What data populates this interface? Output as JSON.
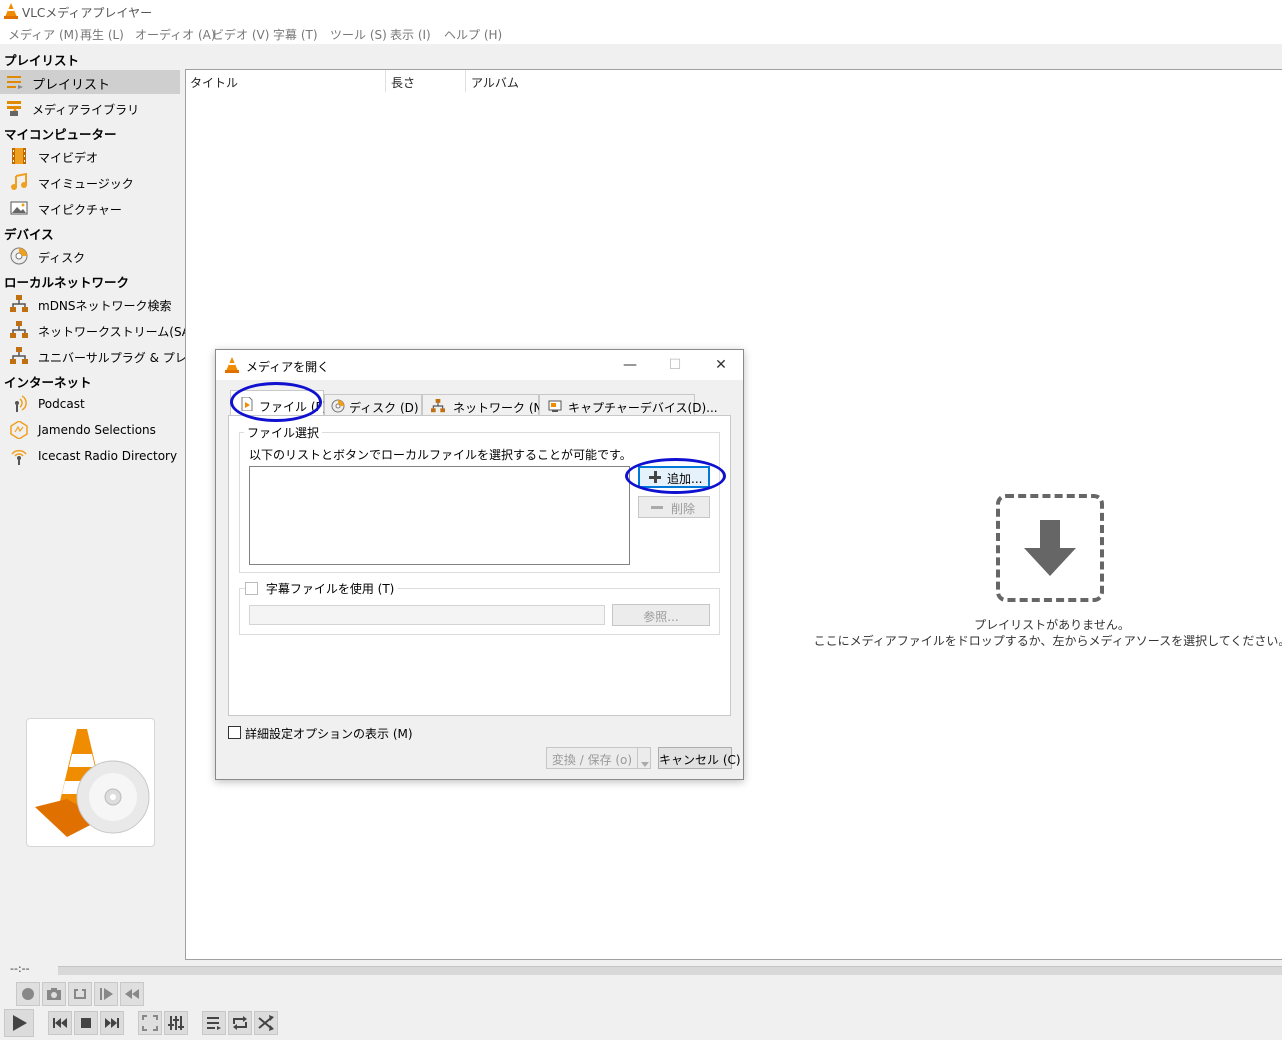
{
  "window": {
    "title": "VLCメディアプレイヤー"
  },
  "menu": [
    "メディア (M)",
    "再生 (L)",
    "オーディオ (A)",
    "ビデオ (V)",
    "字幕 (T)",
    "ツール (S)",
    "表示 (I)",
    "ヘルプ (H)"
  ],
  "sidebar": {
    "playlist_header": "プレイリスト",
    "playlist_items": [
      "プレイリスト",
      "メディアライブラリ"
    ],
    "mycomputer_header": "マイコンピューター",
    "mycomputer_items": [
      "マイビデオ",
      "マイミュージック",
      "マイピクチャー"
    ],
    "devices_header": "デバイス",
    "devices_items": [
      "ディスク"
    ],
    "lan_header": "ローカルネットワーク",
    "lan_items": [
      "mDNSネットワーク検索",
      "ネットワークストリーム(SAP)",
      "ユニバーサルプラグ & プレイ"
    ],
    "internet_header": "インターネット",
    "internet_items": [
      "Podcast",
      "Jamendo Selections",
      "Icecast Radio Directory"
    ]
  },
  "playlist": {
    "columns": [
      "タイトル",
      "長さ",
      "アルバム"
    ],
    "empty_line1": "プレイリストがありません。",
    "empty_line2": "ここにメディアファイルをドロップするか、左からメディアソースを選択してください。"
  },
  "controls": {
    "time": "--:--"
  },
  "dialog": {
    "title": "メディアを開く",
    "window_buttons": {
      "minimize": "—",
      "maximize": "☐",
      "close": "✕"
    },
    "tabs": [
      "ファイル (F)",
      "ディスク (D)",
      "ネットワーク (N)",
      "キャプチャーデバイス(D)..."
    ],
    "file_group_title": "ファイル選択",
    "file_desc": "以下のリストとボタンでローカルファイルを選択することが可能です。",
    "add_button": "追加...",
    "remove_button": "削除",
    "subtitle_checkbox": "字幕ファイルを使用 (T)",
    "browse_button": "参照...",
    "advanced_checkbox": "詳細設定オプションの表示 (M)",
    "convert_button": "変換 / 保存 (o)",
    "cancel_button": "キャンセル (C)"
  },
  "colors": {
    "vlc_orange": "#f08c00",
    "highlight": "#1010d0",
    "focus": "#0078d7"
  }
}
